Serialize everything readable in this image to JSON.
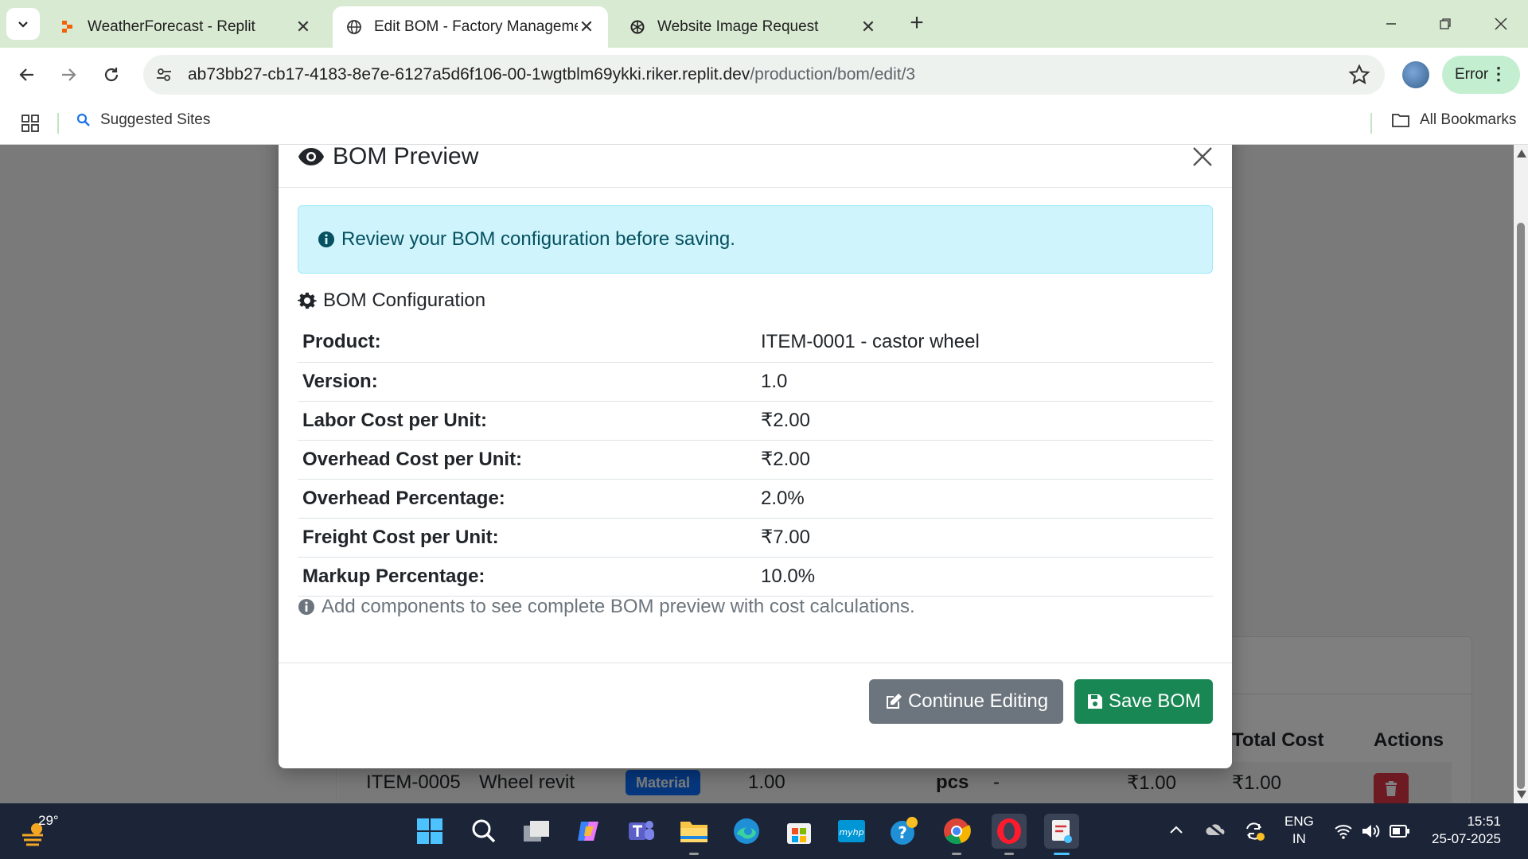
{
  "browser": {
    "tabs": [
      {
        "title": "WeatherForecast - Replit",
        "favicon": "replit-icon",
        "active": false
      },
      {
        "title": "Edit BOM - Factory Management",
        "favicon": "globe-icon",
        "active": true
      },
      {
        "title": "Website Image Request",
        "favicon": "openai-icon",
        "active": false
      }
    ],
    "url_host": "ab73bb27-cb17-4183-8e7e-6127a5d6f106-00-1wgtblm69ykki.riker.replit.dev",
    "url_path": "/production/bom/edit/3",
    "error_label": "Error",
    "bookmarks": {
      "suggested": "Suggested Sites",
      "all": "All Bookmarks"
    }
  },
  "background_table": {
    "headers": {
      "total_cost": "Total Cost",
      "actions": "Actions"
    },
    "row": {
      "code": "ITEM-0005",
      "name": "Wheel revit",
      "type_badge": "Material",
      "qty": "1.00",
      "unit": "pcs",
      "dash": "-",
      "unit_cost": "₹1.00",
      "total_cost": "₹1.00"
    }
  },
  "modal": {
    "title": "BOM Preview",
    "alert": "Review your BOM configuration before saving.",
    "section_title": "BOM Configuration",
    "config": [
      {
        "label": "Product:",
        "value": "ITEM-0001 - castor wheel"
      },
      {
        "label": "Version:",
        "value": "1.0"
      },
      {
        "label": "Labor Cost per Unit:",
        "value": "₹2.00"
      },
      {
        "label": "Overhead Cost per Unit:",
        "value": "₹2.00"
      },
      {
        "label": "Overhead Percentage:",
        "value": "2.0%"
      },
      {
        "label": "Freight Cost per Unit:",
        "value": "₹7.00"
      },
      {
        "label": "Markup Percentage:",
        "value": "10.0%"
      }
    ],
    "note": "Add components to see complete BOM preview with cost calculations.",
    "buttons": {
      "continue": "Continue Editing",
      "save": "Save BOM"
    }
  },
  "taskbar": {
    "weather_temp": "29°",
    "lang_line1": "ENG",
    "lang_line2": "IN",
    "time": "15:51",
    "date": "25-07-2025"
  },
  "colors": {
    "info_bg": "#cff4fc",
    "info_text": "#055160",
    "secondary": "#6c757d",
    "success": "#198754",
    "danger": "#dc3545",
    "primary": "#0d6efd",
    "chrome_green": "#d9ead3"
  }
}
